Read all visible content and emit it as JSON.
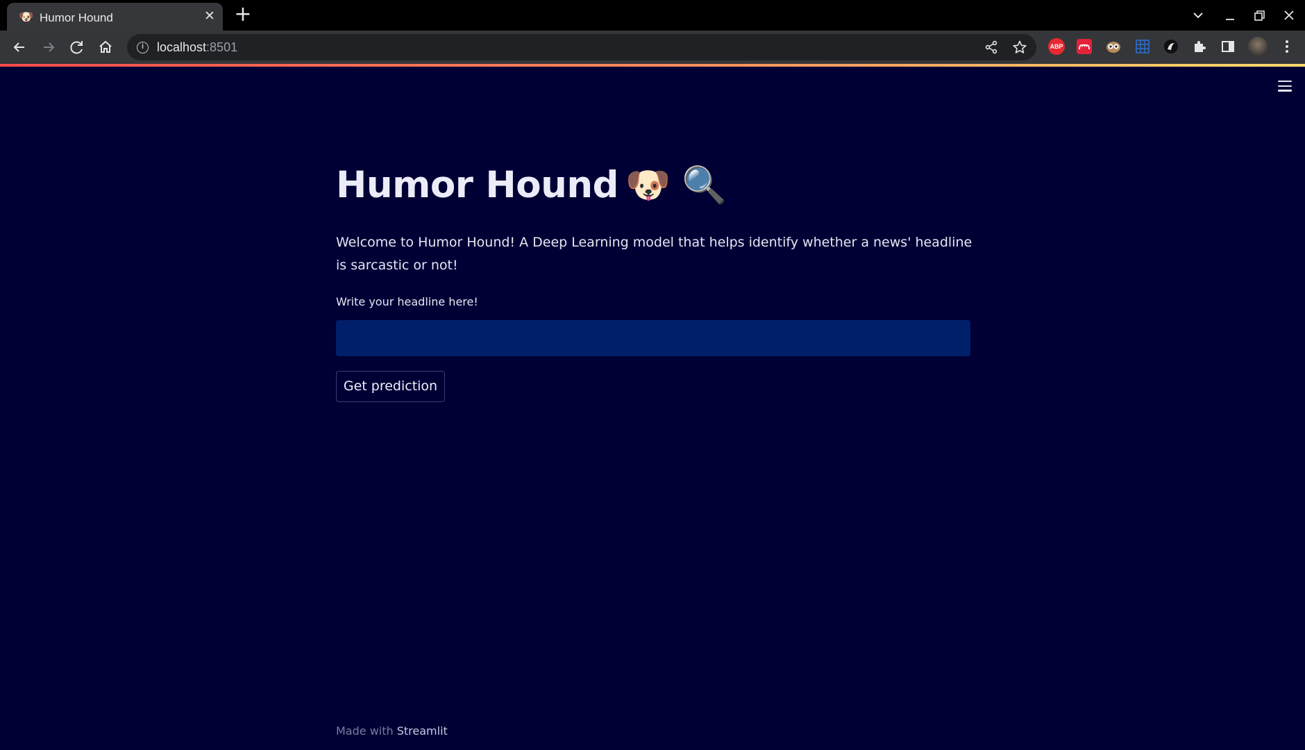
{
  "browser": {
    "tab": {
      "title": "Humor Hound",
      "favicon": "dog-face-emoji",
      "close_label": "✕"
    },
    "new_tab_label": "+",
    "window_controls": {
      "minimize": "—",
      "restore": "❐",
      "close": "✕"
    },
    "address_bar": {
      "host": "localhost",
      "port": ":8501"
    },
    "extensions": [
      {
        "name": "adblock-plus-icon",
        "label": "ABP",
        "color": "#e8272f"
      },
      {
        "name": "mendeley-icon",
        "color": "#e4223a"
      },
      {
        "name": "owl-extension-icon",
        "color": "#cfcfcf"
      },
      {
        "name": "translate-grid-icon",
        "color": "#2b6fd1"
      },
      {
        "name": "paw-extension-icon",
        "color": "#111111"
      }
    ]
  },
  "app": {
    "title": "Humor Hound",
    "title_emojis": "🐶 🔍",
    "intro": "Welcome to Humor Hound! A Deep Learning model that helps identify whether a news' headline is sarcastic or not!",
    "input": {
      "label": "Write your headline here!",
      "value": ""
    },
    "button_label": "Get prediction",
    "footer": {
      "prefix": "Made with ",
      "brand": "Streamlit"
    }
  },
  "colors": {
    "background": "#000035",
    "input_background": "#001f6b",
    "text": "#e6e6f4",
    "gradient": [
      "#ff4b4b",
      "#ff8a5b",
      "#fdd96c"
    ]
  }
}
